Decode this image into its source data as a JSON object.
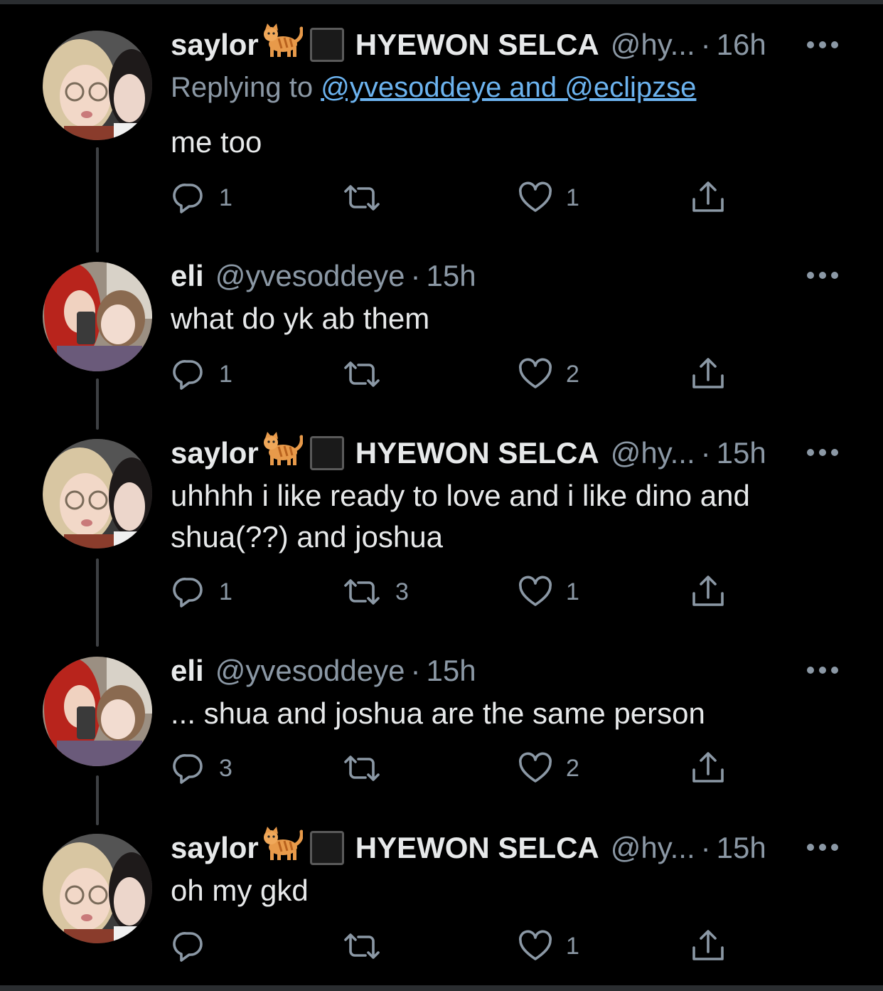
{
  "tweets": [
    {
      "name": "saylor",
      "name2": "HYEWON SELCA",
      "handle": "@hy...",
      "time": "16h",
      "replying_prefix": "Replying to ",
      "replying_mentions": "@yvesoddeye and @eclipzse",
      "text": "me too",
      "reply_count": "1",
      "retweet_count": "",
      "like_count": "1"
    },
    {
      "name": "eli",
      "handle": "@yvesoddeye",
      "time": "15h",
      "text": "what do yk ab them",
      "reply_count": "1",
      "retweet_count": "",
      "like_count": "2"
    },
    {
      "name": "saylor",
      "name2": "HYEWON SELCA",
      "handle": "@hy...",
      "time": "15h",
      "text": "uhhhh i like ready to love and i like dino and shua(??) and joshua",
      "reply_count": "1",
      "retweet_count": "3",
      "like_count": "1"
    },
    {
      "name": "eli",
      "handle": "@yvesoddeye",
      "time": "15h",
      "text": "... shua and joshua are the same person",
      "reply_count": "3",
      "retweet_count": "",
      "like_count": "2"
    },
    {
      "name": "saylor",
      "name2": "HYEWON SELCA",
      "handle": "@hy...",
      "time": "15h",
      "text": "oh my gkd",
      "reply_count": "",
      "retweet_count": "",
      "like_count": "1"
    }
  ],
  "ui": {
    "dot_separator": "·",
    "icons": [
      "reply-icon",
      "retweet-icon",
      "like-icon",
      "share-icon",
      "more-icon",
      "cat-emoji",
      "black-square-emoji"
    ]
  },
  "colors": {
    "background": "#000000",
    "text": "#e7e9ea",
    "secondary": "#8b98a5",
    "link": "#6cb3ef",
    "thread_line": "#3e4144"
  }
}
